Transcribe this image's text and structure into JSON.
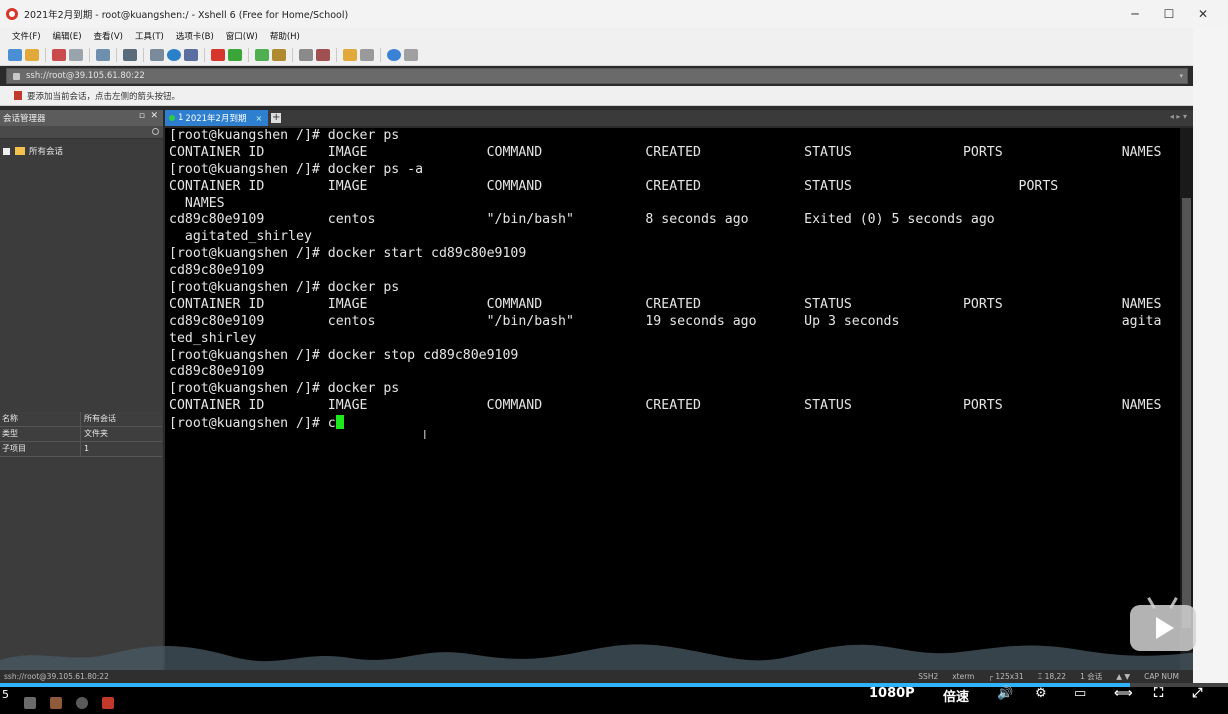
{
  "window": {
    "title": "2021年2月到期 - root@kuangshen:/ - Xshell 6 (Free for Home/School)",
    "controls": [
      "─",
      "☐",
      "✕"
    ]
  },
  "menu": [
    "文件(F)",
    "编辑(E)",
    "查看(V)",
    "工具(T)",
    "选项卡(B)",
    "窗口(W)",
    "帮助(H)"
  ],
  "address": {
    "value": "ssh://root@39.105.61.80:22"
  },
  "hint": "要添加当前会话，点击左侧的箭头按钮。",
  "sidebar": {
    "title": "会话管理器",
    "pin": "▫",
    "close": "✕",
    "tree_item": "所有会话",
    "properties": [
      {
        "key": "名称",
        "value": "所有会话"
      },
      {
        "key": "类型",
        "value": "文件夹"
      },
      {
        "key": "子项目",
        "value": "1"
      }
    ]
  },
  "tab": {
    "number": "1",
    "label": "2021年2月到期",
    "close": "×",
    "add": "+",
    "nav": "◂ ▸ ▾"
  },
  "terminal": {
    "lines": [
      "[root@kuangshen /]# docker ps",
      "CONTAINER ID        IMAGE               COMMAND             CREATED             STATUS              PORTS               NAMES",
      "[root@kuangshen /]# docker ps -a",
      "CONTAINER ID        IMAGE               COMMAND             CREATED             STATUS                     PORTS",
      "  NAMES",
      "cd89c80e9109        centos              \"/bin/bash\"         8 seconds ago       Exited (0) 5 seconds ago",
      "  agitated_shirley",
      "[root@kuangshen /]# docker start cd89c80e9109",
      "cd89c80e9109",
      "[root@kuangshen /]# docker ps",
      "CONTAINER ID        IMAGE               COMMAND             CREATED             STATUS              PORTS               NAMES",
      "cd89c80e9109        centos              \"/bin/bash\"         19 seconds ago      Up 3 seconds                            agita",
      "ted_shirley",
      "[root@kuangshen /]# docker stop cd89c80e9109",
      "cd89c80e9109",
      "[root@kuangshen /]# docker ps",
      "CONTAINER ID        IMAGE               COMMAND             CREATED             STATUS              PORTS               NAMES"
    ],
    "prompt": "[root@kuangshen /]# ",
    "typed": "c"
  },
  "status": {
    "session": "ssh://root@39.105.61.80:22",
    "segments": [
      "SSH2",
      "xterm",
      "┌ 125x31",
      "⌶ 18,22",
      "1 会话",
      "▲ ▼",
      "CAP  NUM"
    ]
  },
  "video": {
    "progress": 0.92,
    "time_fragment": "5",
    "quality": "1080P",
    "speed": "倍速",
    "accent": "#2fb3ff"
  }
}
